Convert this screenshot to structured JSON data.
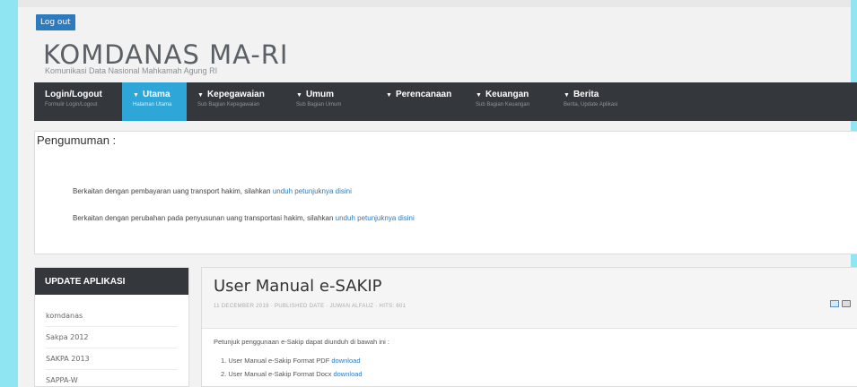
{
  "header": {
    "logout_label": "Log out",
    "site_title": "KOMDANAS MA-RI",
    "site_subtitle": "Komunikasi Data Nasional Mahkamah Agung RI"
  },
  "nav": {
    "items": [
      {
        "label": "Login/Logout",
        "desc": "Formulir Login/Logout",
        "active": false,
        "caret": false
      },
      {
        "label": "Utama",
        "desc": "Halaman Utama",
        "active": true,
        "caret": true
      },
      {
        "label": "Kepegawaian",
        "desc": "Sub Bagian Kepegawaian",
        "active": false,
        "caret": true
      },
      {
        "label": "Umum",
        "desc": "Sub Bagian Umum",
        "active": false,
        "caret": true
      },
      {
        "label": "Perencanaan",
        "desc": "",
        "active": false,
        "caret": true
      },
      {
        "label": "Keuangan",
        "desc": "Sub Bagian Keuangan",
        "active": false,
        "caret": true
      },
      {
        "label": "Berita",
        "desc": "Berita, Update Aplikasi",
        "active": false,
        "caret": true
      }
    ]
  },
  "announcement": {
    "heading": "Pengumuman :",
    "items": [
      {
        "text": "Berkaitan dengan pembayaran uang transport hakim, silahkan ",
        "link": "unduh petunjuknya disini"
      },
      {
        "text": "Berkaitan dengan perubahan pada penyusunan uang transportasi hakim, silahkan ",
        "link": "unduh petunjuknya disini"
      }
    ]
  },
  "sidebar": {
    "title": "UPDATE APLIKASI",
    "items": [
      "komdanas",
      "Sakpa 2012",
      "SAKPA 2013",
      "SAPPA-W"
    ]
  },
  "article": {
    "title": "User Manual e-SAKIP",
    "meta": "11 DECEMBER 2019 · PUBLISHED DATE · JUWAN ALFAUZ · HITS: 601",
    "intro": "Petunjuk penggunaan e-Sakip dapat diunduh di bawah ini :",
    "list": [
      {
        "text": "1. User Manual e-Sakip Format PDF ",
        "link": "download"
      },
      {
        "text": "2. User Manual e-Sakip Format Docx ",
        "link": "download"
      }
    ],
    "tools": [
      "email-icon",
      "print-icon"
    ]
  }
}
